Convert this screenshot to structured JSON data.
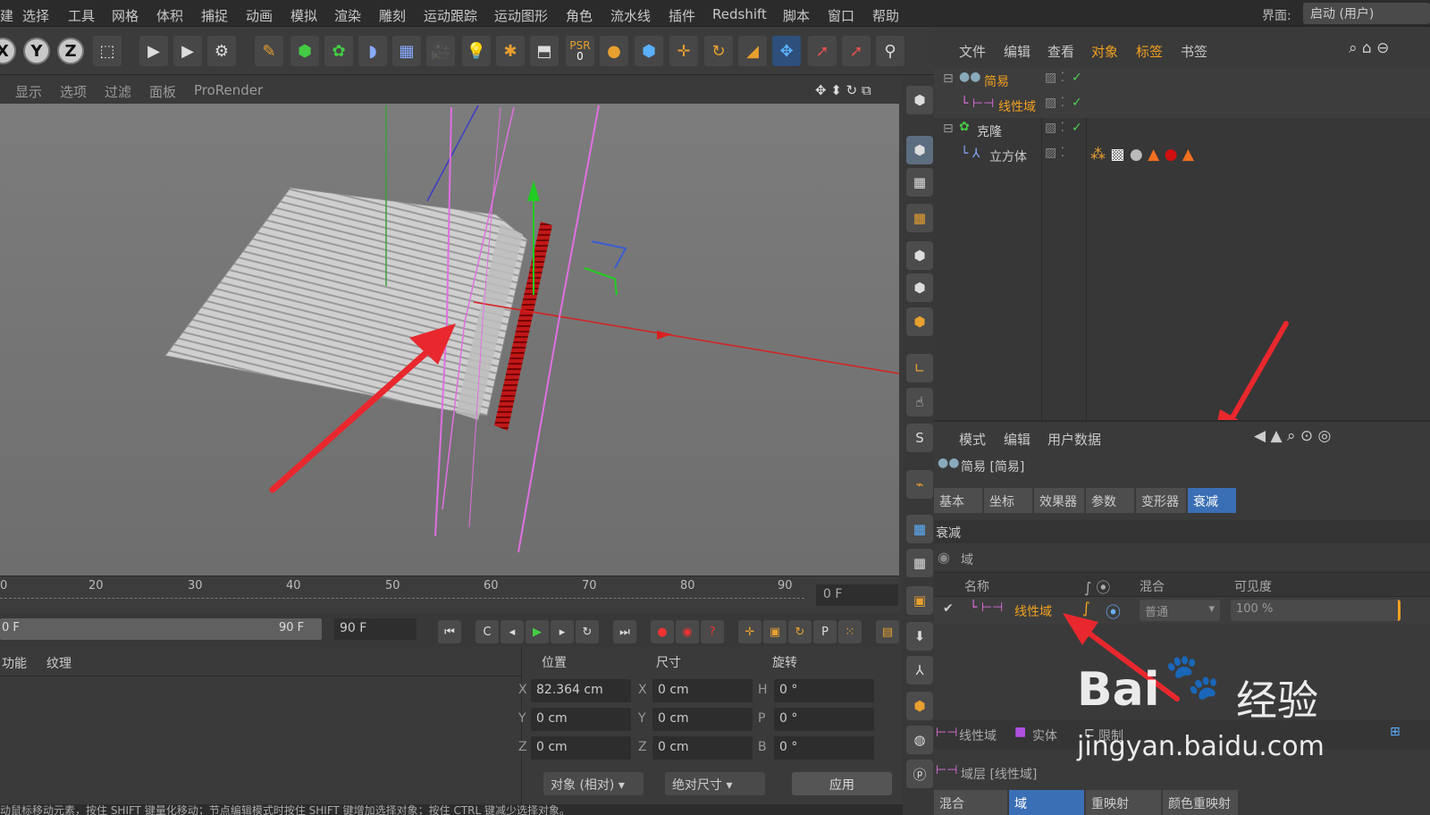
{
  "menubar": {
    "items": [
      "建",
      "选择",
      "工具",
      "网格",
      "体积",
      "捕捉",
      "动画",
      "模拟",
      "渲染",
      "雕刻",
      "运动跟踪",
      "运动图形",
      "角色",
      "流水线",
      "插件",
      "Redshift",
      "脚本",
      "窗口",
      "帮助"
    ],
    "layout_label": "界面:",
    "layout_value": "启动 (用户)"
  },
  "toolbar": {
    "x_label": "X",
    "y_label": "Y",
    "z_label": "Z",
    "psr_label": "PSR",
    "psr_value": "0"
  },
  "viewport": {
    "menu": [
      "显示",
      "选项",
      "过滤",
      "面板",
      "ProRender"
    ]
  },
  "timeline": {
    "ticks": [
      "0",
      "20",
      "30",
      "40",
      "50",
      "60",
      "70",
      "80",
      "90"
    ],
    "current_frame": "0 F",
    "start_frame": "0 F",
    "range_end": "90 F",
    "end_frame": "90 F"
  },
  "material_panel": {
    "tabs": [
      "功能",
      "纹理"
    ]
  },
  "coordinates": {
    "headers": {
      "position": "位置",
      "size": "尺寸",
      "rotation": "旋转"
    },
    "rows": [
      {
        "axis": "X",
        "pos": "82.364 cm",
        "size_axis": "X",
        "size": "0 cm",
        "rot_axis": "H",
        "rot": "0 °"
      },
      {
        "axis": "Y",
        "pos": "0 cm",
        "size_axis": "Y",
        "size": "0 cm",
        "rot_axis": "P",
        "rot": "0 °"
      },
      {
        "axis": "Z",
        "pos": "0 cm",
        "size_axis": "Z",
        "size": "0 cm",
        "rot_axis": "B",
        "rot": "0 °"
      }
    ],
    "mode_select": "对象 (相对)",
    "size_select": "绝对尺寸",
    "apply_label": "应用"
  },
  "status_text": "动鼠标移动元素，按住 SHIFT 键量化移动；节点编辑模式时按住 SHIFT 键增加选择对象；按住 CTRL 键减少选择对象。",
  "object_manager": {
    "menu": [
      "文件",
      "编辑",
      "查看",
      "对象",
      "标签",
      "书签"
    ],
    "objects": [
      {
        "name": "简易",
        "highlighted": true
      },
      {
        "name": "线性域",
        "highlighted": true
      },
      {
        "name": "克隆",
        "highlighted": false
      },
      {
        "name": "立方体",
        "highlighted": false
      }
    ]
  },
  "attribute_manager": {
    "menu": [
      "模式",
      "编辑",
      "用户数据"
    ],
    "object_title": "简易 [简易]",
    "tabs": [
      "基本",
      "坐标",
      "效果器",
      "参数",
      "变形器",
      "衰减"
    ],
    "active_tab": "衰减",
    "section_title": "衰减",
    "field_label": "域",
    "columns": {
      "name": "名称",
      "blend": "混合",
      "visibility": "可见度"
    },
    "field_row": {
      "name": "线性域",
      "blend_mode": "普通",
      "visibility": "100 %"
    },
    "field_buttons": [
      "线性域",
      "实体",
      "限制"
    ],
    "layer_label": "域层 [线性域]",
    "bottom_tabs": [
      "混合",
      "域",
      "重映射",
      "颜色重映射"
    ]
  },
  "watermark": {
    "brand": "Bai",
    "brand_cn": "经验",
    "url": "jingyan.baidu.com"
  },
  "colors": {
    "accent_orange": "#f0a020",
    "arrow_red": "#e8282e",
    "active_tab_blue": "#3b6fb5",
    "field_magenta": "#e070e0"
  }
}
